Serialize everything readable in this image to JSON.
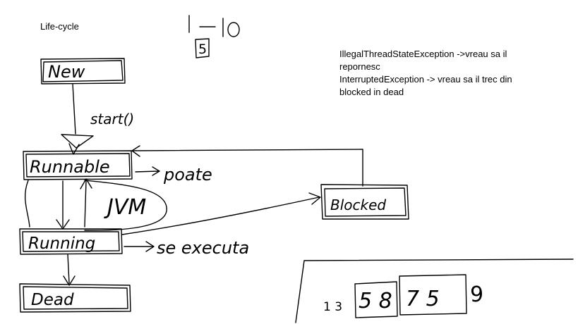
{
  "title": "Life-cycle",
  "notes": [
    "IllegalThreadStateException ->vreau sa il",
    "repornesc",
    "InterruptedException -> vreau sa il trec din",
    "blocked in dead"
  ],
  "states": {
    "new": "New",
    "runnable": "Runnable",
    "running": "Running",
    "blocked": "Blocked",
    "dead": "Dead"
  },
  "labels": {
    "start": "start()",
    "poate": "poate",
    "jvm": "JVM",
    "se_executa": "se executa"
  },
  "scribbles": {
    "range": "1-10",
    "five": "5",
    "sequence_left": "1 3",
    "boxed_a": "5 8",
    "boxed_b": "7 5",
    "trailing": "9"
  },
  "colors": {
    "ink": "#000000",
    "background": "#ffffff"
  }
}
